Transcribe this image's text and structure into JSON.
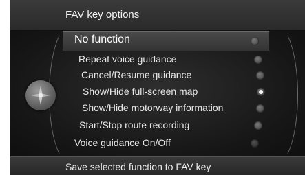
{
  "header": {
    "title": "FAV key options"
  },
  "menu": {
    "items": [
      {
        "label": "No function",
        "selected": true,
        "checked": false
      },
      {
        "label": "Repeat voice guidance",
        "selected": false,
        "checked": false
      },
      {
        "label": "Cancel/Resume guidance",
        "selected": false,
        "checked": false
      },
      {
        "label": "Show/Hide full-screen map",
        "selected": false,
        "checked": true
      },
      {
        "label": "Show/Hide motorway information",
        "selected": false,
        "checked": false
      },
      {
        "label": "Start/Stop route recording",
        "selected": false,
        "checked": false
      },
      {
        "label": "Voice guidance On/Off",
        "selected": false,
        "checked": false
      }
    ]
  },
  "footer": {
    "text": "Save selected function to FAV key"
  },
  "icons": {
    "knob": "compass-knob-icon"
  }
}
